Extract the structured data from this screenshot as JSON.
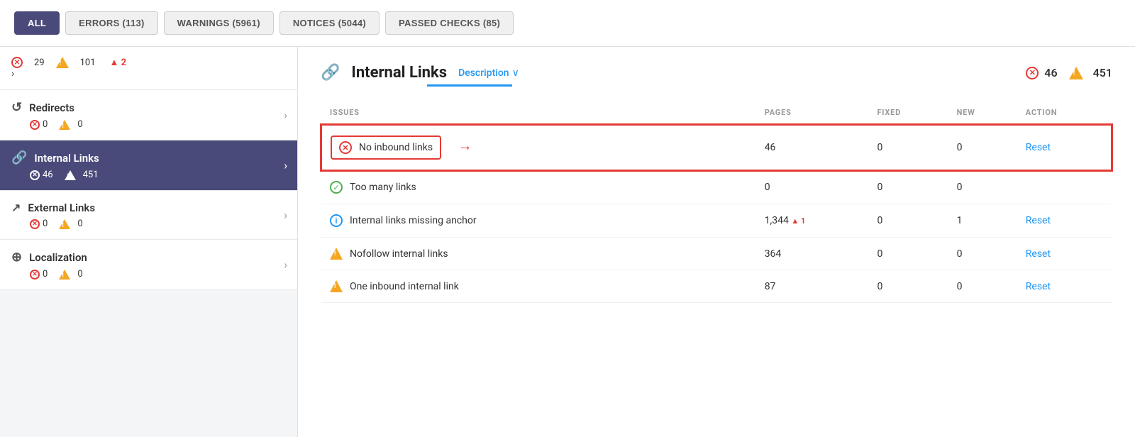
{
  "tabs": [
    {
      "label": "ALL",
      "active": true
    },
    {
      "label": "ERRORS (113)",
      "active": false
    },
    {
      "label": "WARNINGS (5961)",
      "active": false
    },
    {
      "label": "NOTICES (5044)",
      "active": false
    },
    {
      "label": "PASSED CHECKS (85)",
      "active": false
    }
  ],
  "sidebar": {
    "top_item": {
      "error_count": "29",
      "warning_count": "101",
      "badge": "▲ 2"
    },
    "items": [
      {
        "id": "redirects",
        "icon": "redirect-icon",
        "label": "Redirects",
        "error_count": "0",
        "warning_count": "0",
        "active": false
      },
      {
        "id": "internal-links",
        "icon": "link-icon",
        "label": "Internal Links",
        "error_count": "46",
        "warning_count": "451",
        "active": true
      },
      {
        "id": "external-links",
        "icon": "external-link-icon",
        "label": "External Links",
        "error_count": "0",
        "warning_count": "0",
        "active": false
      },
      {
        "id": "localization",
        "icon": "globe-icon",
        "label": "Localization",
        "error_count": "0",
        "warning_count": "0",
        "active": false
      }
    ]
  },
  "content": {
    "title": "Internal Links",
    "description_label": "Description",
    "header_errors": "46",
    "header_warnings": "451",
    "columns": {
      "issues": "ISSUES",
      "pages": "PAGES",
      "fixed": "FIXED",
      "new": "NEW",
      "action": "ACTION"
    },
    "issues": [
      {
        "icon": "error-icon",
        "name": "No inbound links",
        "pages": "46",
        "fixed": "0",
        "new": "0",
        "action": "Reset",
        "highlighted": true,
        "badge": "",
        "has_arrow": true
      },
      {
        "icon": "check-icon",
        "name": "Too many links",
        "pages": "0",
        "fixed": "0",
        "new": "0",
        "action": "",
        "highlighted": false,
        "badge": "",
        "has_arrow": false
      },
      {
        "icon": "info-icon",
        "name": "Internal links missing anchor",
        "pages": "1,344",
        "fixed": "0",
        "new": "1",
        "action": "Reset",
        "highlighted": false,
        "badge": "▲ 1",
        "has_arrow": false
      },
      {
        "icon": "warning-icon",
        "name": "Nofollow internal links",
        "pages": "364",
        "fixed": "0",
        "new": "0",
        "action": "Reset",
        "highlighted": false,
        "badge": "",
        "has_arrow": false
      },
      {
        "icon": "warning-icon",
        "name": "One inbound internal link",
        "pages": "87",
        "fixed": "0",
        "new": "0",
        "action": "Reset",
        "highlighted": false,
        "badge": "",
        "has_arrow": false
      }
    ]
  }
}
